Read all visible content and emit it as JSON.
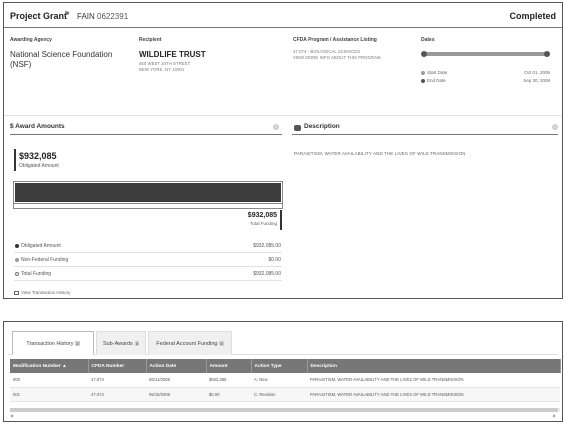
{
  "header": {
    "award_type": "Project Grant",
    "fain_label": "FAIN",
    "fain": "0622391",
    "status": "Completed"
  },
  "agency": {
    "label": "Awarding Agency",
    "name": "National Science Foundation (NSF)"
  },
  "recipient": {
    "label": "Recipient",
    "name": "WILDLIFE TRUST",
    "address_line1": "460 WEST 34TH STREET",
    "address_line2": "NEW YORK, NY 10001"
  },
  "cfda": {
    "label": "CFDA Program / Assistance Listing",
    "line1": "47.074 - BIOLOGICAL SCIENCES",
    "line2": "VIEW MORE INFO ABOUT THIS PROGRAM"
  },
  "dates": {
    "label": "Dates",
    "start_label": "Start Date",
    "start_value": "Oct 01, 2006",
    "end_label": "End Date",
    "end_value": "Sep 30, 2008",
    "start_color": "#9a9a9a",
    "end_color": "#555555"
  },
  "award_amounts": {
    "title": "$ Award Amounts",
    "obligated_value": "$932,085",
    "obligated_label": "Obligated Amount",
    "total_value": "$932,085",
    "total_label": "Total Funding",
    "obligated_fraction": 1.0,
    "legend": [
      {
        "label": "Obligated Amount",
        "value": "$932,085.00",
        "color": "#333333"
      },
      {
        "label": "Non-Federal Funding",
        "value": "$0.00",
        "color": "#9a9a9a"
      },
      {
        "label": "Total Funding",
        "value": "$932,085.00",
        "color": "#ffffff"
      }
    ],
    "view_transactions": "View Transaction History"
  },
  "description": {
    "title": "Description",
    "text": "PARASITISM, WATER AVAILABILITY AND THE LIVES OF WILD TRANSMISSION"
  },
  "tabs": [
    {
      "label": "Transaction History",
      "count": "2"
    },
    {
      "label": "Sub-Awards",
      "count": "0"
    },
    {
      "label": "Federal Account Funding",
      "count": "0"
    }
  ],
  "table": {
    "columns": [
      "Modification Number",
      "CFDA Number",
      "Action Date",
      "Amount",
      "Action Type",
      "Description"
    ],
    "rows": [
      [
        "000",
        "47.074",
        "06/14/2006",
        "$932,085",
        "A: New",
        "PARASITISM, WATER AVAILABILITY AND THE LIVES OF WILD TRANSMISSION"
      ],
      [
        "001",
        "47.074",
        "05/15/2008",
        "$0.00",
        "C: Revision",
        "PARASITISM, WATER AVAILABILITY AND THE LIVES OF WILD TRANSMISSION"
      ]
    ]
  },
  "colors": {
    "bar_fill": "#3d3d3d",
    "table_header": "#777777"
  }
}
